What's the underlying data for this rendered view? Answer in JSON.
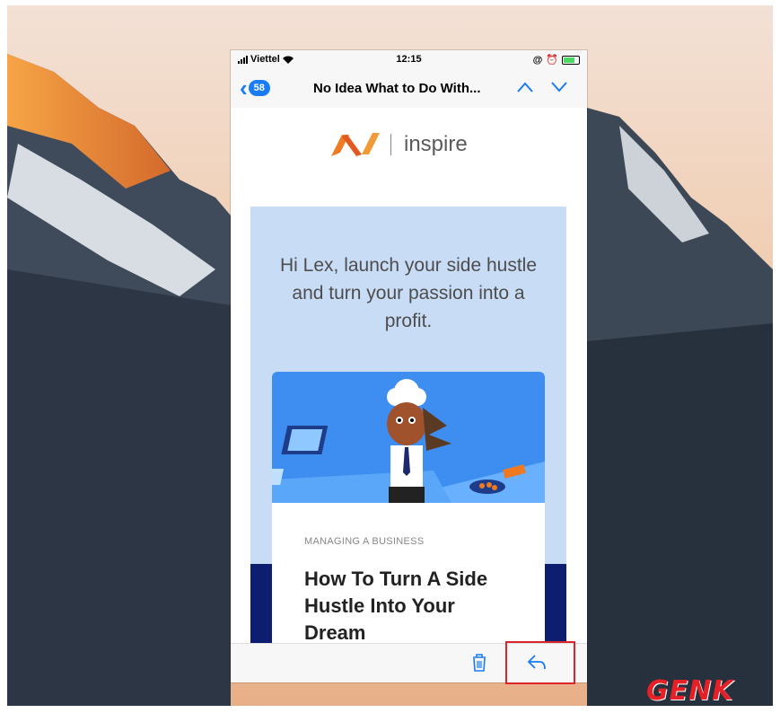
{
  "status_bar": {
    "carrier": "Viettel",
    "time": "12:15"
  },
  "nav": {
    "back_badge": "58",
    "title": "No Idea What to Do With..."
  },
  "email": {
    "logo_text": "inspire",
    "greeting": "Hi Lex, launch your side hustle and turn your passion into a profit.",
    "category": "MANAGING A BUSINESS",
    "article_title": "How To Turn A Side Hustle Into Your Dream"
  },
  "watermark": "GENK",
  "icons": [
    "back-chevron-icon",
    "chevron-up-icon",
    "chevron-down-icon",
    "trash-icon",
    "reply-icon",
    "wifi-icon",
    "battery-icon",
    "alarm-icon",
    "lock-rotation-icon"
  ],
  "colors": {
    "accent": "#1a7cf5",
    "panel": "#c9dcf6",
    "highlight": "#d9252b",
    "brand_orange": "#f07a22"
  }
}
